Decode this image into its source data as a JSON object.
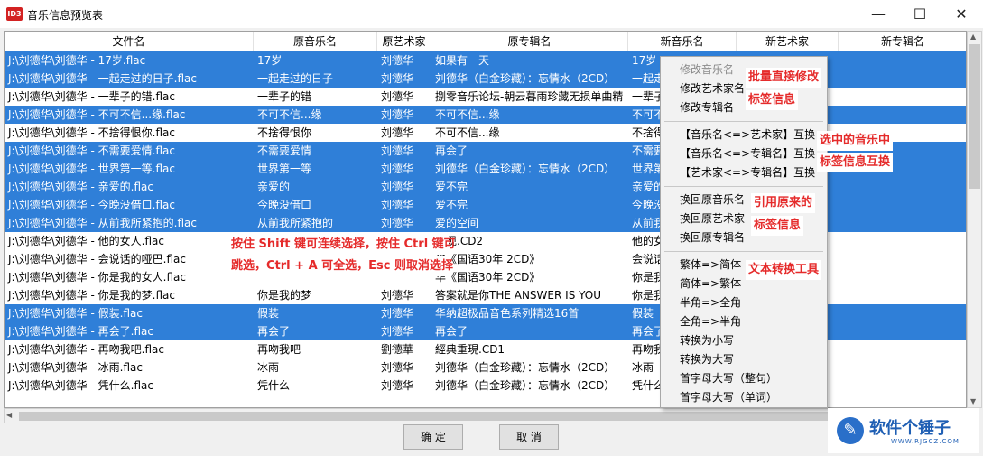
{
  "window": {
    "icon_text": "ID3",
    "title": "音乐信息预览表",
    "minimize": "—",
    "maximize": "☐",
    "close": "✕"
  },
  "columns": [
    "文件名",
    "原音乐名",
    "原艺术家",
    "原专辑名",
    "新音乐名",
    "新艺术家",
    "新专辑名"
  ],
  "rows": [
    {
      "selected": true,
      "file": "J:\\刘德华\\刘德华 - 17岁.flac",
      "title": "17岁",
      "artist": "刘德华",
      "album": "如果有一天",
      "new_title": "17岁"
    },
    {
      "selected": true,
      "file": "J:\\刘德华\\刘德华 - 一起走过的日子.flac",
      "title": "一起走过的日子",
      "artist": "刘德华",
      "album": "刘德华（白金珍藏）：忘情水（2CD）",
      "new_title": "一起走"
    },
    {
      "selected": false,
      "file": "J:\\刘德华\\刘德华 - 一辈子的错.flac",
      "title": "一辈子的错",
      "artist": "刘德华",
      "album": "捌零音乐论坛-朝云暮雨珍藏无损单曲精",
      "new_title": "一辈子"
    },
    {
      "selected": true,
      "file": "J:\\刘德华\\刘德华 - 不可不信...缘.flac",
      "title": "不可不信...缘",
      "artist": "刘德华",
      "album": "不可不信...缘",
      "new_title": "不可不"
    },
    {
      "selected": false,
      "file": "J:\\刘德华\\刘德华 - 不捨得恨你.flac",
      "title": "不捨得恨你",
      "artist": "刘德华",
      "album": "不可不信...缘",
      "new_title": "不捨得"
    },
    {
      "selected": true,
      "file": "J:\\刘德华\\刘德华 - 不需要爱情.flac",
      "title": "不需要爱情",
      "artist": "刘德华",
      "album": "再会了",
      "new_title": "不需要"
    },
    {
      "selected": true,
      "file": "J:\\刘德华\\刘德华 - 世界第一等.flac",
      "title": "世界第一等",
      "artist": "刘德华",
      "album": "刘德华（白金珍藏）：忘情水（2CD）",
      "new_title": "世界第"
    },
    {
      "selected": true,
      "file": "J:\\刘德华\\刘德华 - 亲爱的.flac",
      "title": "亲爱的",
      "artist": "刘德华",
      "album": "爱不完",
      "new_title": "亲爱的"
    },
    {
      "selected": true,
      "file": "J:\\刘德华\\刘德华 - 今晚没借口.flac",
      "title": "今晚没借口",
      "artist": "刘德华",
      "album": "爱不完",
      "new_title": "今晚没"
    },
    {
      "selected": true,
      "file": "J:\\刘德华\\刘德华 - 从前我所紧抱的.flac",
      "title": "从前我所紧抱的",
      "artist": "刘德华",
      "album": "爱的空间",
      "new_title": "从前我"
    },
    {
      "selected": false,
      "file": "J:\\刘德华\\刘德华 - 他的女人.flac",
      "title": "",
      "artist": "",
      "album": "重现.CD2",
      "new_title": "他的女"
    },
    {
      "selected": false,
      "file": "J:\\刘德华\\刘德华 - 会说话的哑巴.flac",
      "title": "",
      "artist": "",
      "album": "华《国语30年 2CD》",
      "new_title": "会说话"
    },
    {
      "selected": false,
      "file": "J:\\刘德华\\刘德华 - 你是我的女人.flac",
      "title": "",
      "artist": "",
      "album": "华《国语30年 2CD》",
      "new_title": "你是我"
    },
    {
      "selected": false,
      "file": "J:\\刘德华\\刘德华 - 你是我的梦.flac",
      "title": "你是我的梦",
      "artist": "刘德华",
      "album": "答案就是你THE ANSWER IS YOU",
      "new_title": "你是我"
    },
    {
      "selected": true,
      "file": "J:\\刘德华\\刘德华 - 假装.flac",
      "title": "假装",
      "artist": "刘德华",
      "album": "华纳超极品音色系列精选16首",
      "new_title": "假装"
    },
    {
      "selected": true,
      "file": "J:\\刘德华\\刘德华 - 再会了.flac",
      "title": "再会了",
      "artist": "刘德华",
      "album": "再会了",
      "new_title": "再会了"
    },
    {
      "selected": false,
      "file": "J:\\刘德华\\刘德华 - 再吻我吧.flac",
      "title": "再吻我吧",
      "artist": "劉德華",
      "album": "經典重現.CD1",
      "new_title": "再吻我"
    },
    {
      "selected": false,
      "file": "J:\\刘德华\\刘德华 - 冰雨.flac",
      "title": "冰雨",
      "artist": "刘德华",
      "album": "刘德华（白金珍藏）：忘情水（2CD）",
      "new_title": "冰雨"
    },
    {
      "selected": false,
      "file": "J:\\刘德华\\刘德华 - 凭什么.flac",
      "title": "凭什么",
      "artist": "刘德华",
      "album": "刘德华（白金珍藏）：忘情水（2CD）",
      "new_title": "凭什么"
    }
  ],
  "context_menu": {
    "group1": [
      "修改音乐名",
      "修改艺术家名",
      "修改专辑名"
    ],
    "group2": [
      "【音乐名<=>艺术家】互换",
      "【音乐名<=>专辑名】互换",
      "【艺术家<=>专辑名】互换"
    ],
    "group3": [
      "换回原音乐名",
      "换回原艺术家",
      "换回原专辑名"
    ],
    "group4": [
      "繁体=>简体",
      "简体=>繁体",
      "半角=>全角",
      "全角=>半角",
      "转换为小写",
      "转换为大写",
      "首字母大写（整句）",
      "首字母大写（单词）"
    ]
  },
  "annotations": {
    "batch_1": "批量直接修改",
    "batch_2": "标签信息",
    "swap_1": "选中的音乐中",
    "swap_2": "标签信息互换",
    "restore_1": "引用原来的",
    "restore_2": "标签信息",
    "text_tool": "文本转换工具",
    "hint_1": "按住 Shift 键可连续选择，按住 Ctrl 键可",
    "hint_2": "跳选，Ctrl + A 可全选，Esc 则取消选择"
  },
  "buttons": {
    "ok": "确 定",
    "cancel": "取 消"
  },
  "watermark": {
    "logo": "✎",
    "name": "软件个锤子",
    "url": "WWW.RJGCZ.COM"
  },
  "colors": {
    "selection": "#2f7fd8",
    "annotation": "#e52b2b",
    "watermark": "#1f5fb4"
  }
}
